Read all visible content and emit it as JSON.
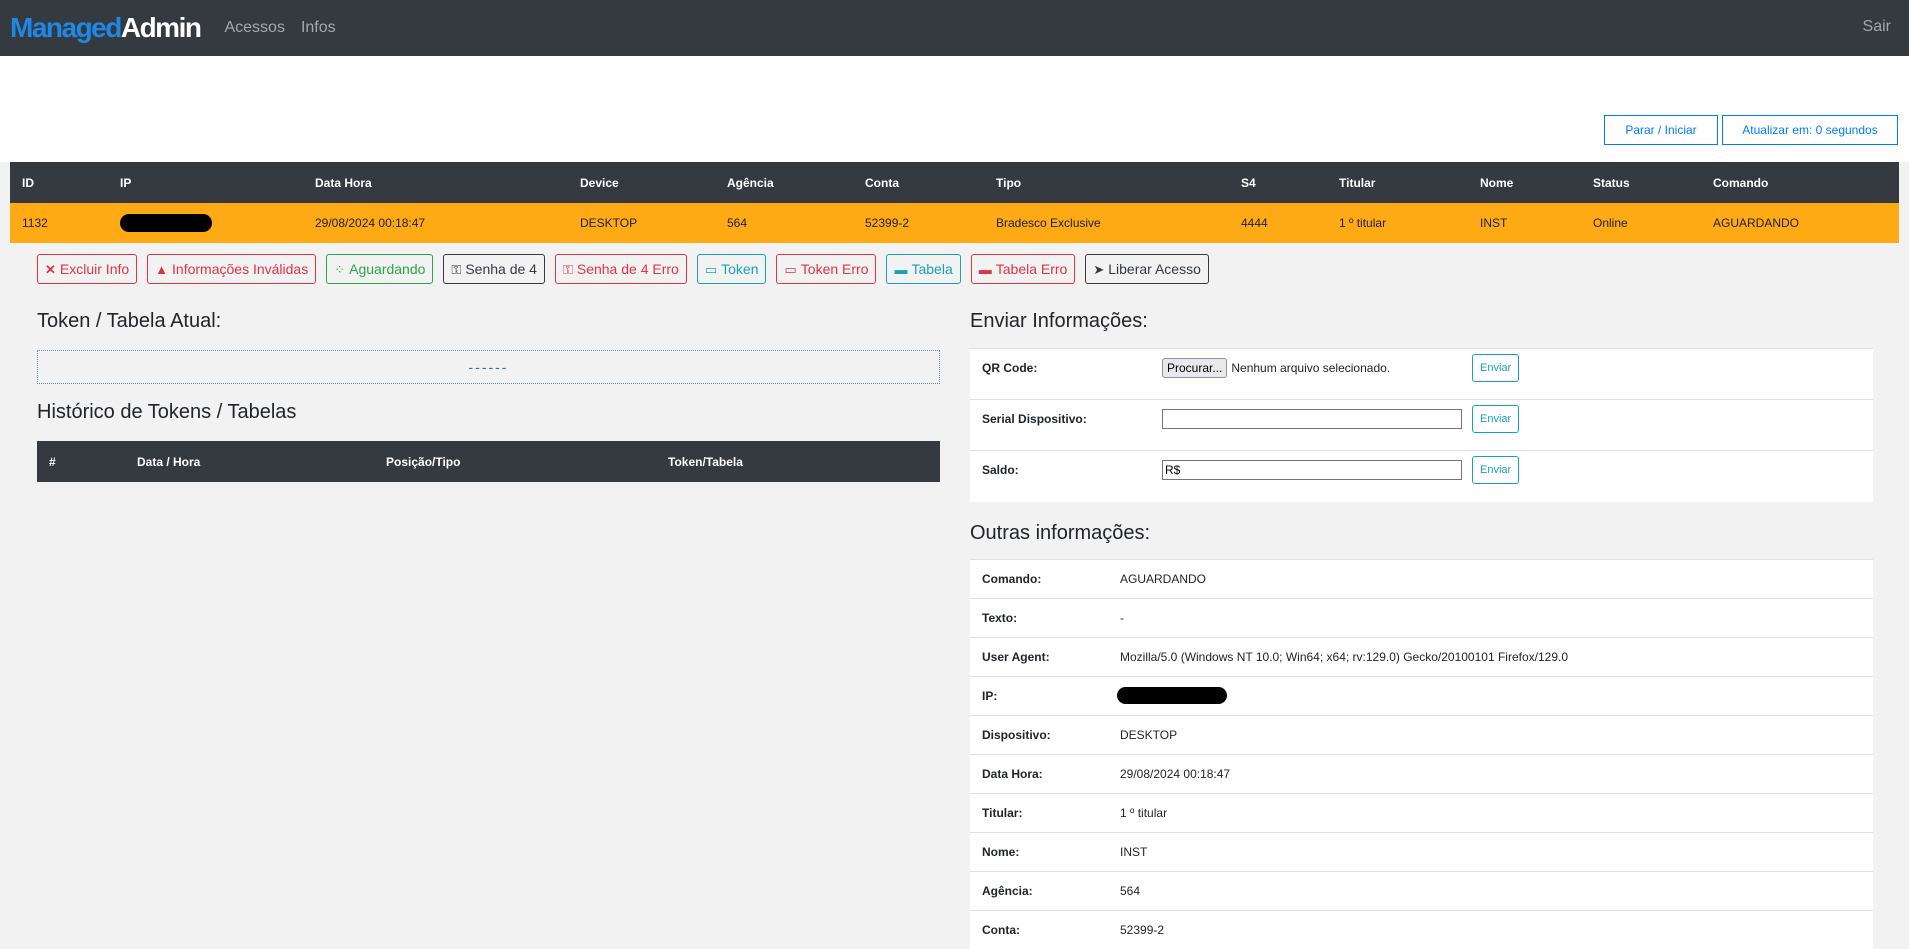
{
  "navbar": {
    "brand_part1": "Managed",
    "brand_part2": "Admin",
    "links": [
      "Acessos",
      "Infos"
    ],
    "logout": "Sair"
  },
  "top_buttons": {
    "stop_start": "Parar / Iniciar",
    "refresh": "Atualizar em: 0 segundos"
  },
  "main_table": {
    "headers": [
      "ID",
      "IP",
      "Data Hora",
      "Device",
      "Agência",
      "Conta",
      "Tipo",
      "S4",
      "Titular",
      "Nome",
      "Status",
      "Comando"
    ],
    "row": {
      "id": "1132",
      "ip": "",
      "data_hora": "29/08/2024 00:18:47",
      "device": "DESKTOP",
      "agencia": "564",
      "conta": "52399-2",
      "tipo": "Bradesco Exclusive",
      "s4": "4444",
      "titular": "1 º titular",
      "nome": "INST",
      "status": "Online",
      "comando": "AGUARDANDO"
    },
    "row_color": "#fdaa14",
    "status_color": "#28a745"
  },
  "action_buttons": [
    {
      "label": "Excluir Info",
      "icon": "x-icon",
      "color": "#dc3545"
    },
    {
      "label": "Informações Inválidas",
      "icon": "warning-icon",
      "color": "#dc3545"
    },
    {
      "label": "Aguardando",
      "icon": "spinner-icon",
      "color": "#28a745"
    },
    {
      "label": "Senha de 4",
      "icon": "key-icon",
      "color": "#343a40"
    },
    {
      "label": "Senha de 4 Erro",
      "icon": "key-icon",
      "color": "#dc3545"
    },
    {
      "label": "Token",
      "icon": "card-icon",
      "color": "#17a2b8"
    },
    {
      "label": "Token Erro",
      "icon": "card-icon",
      "color": "#dc3545"
    },
    {
      "label": "Tabela",
      "icon": "credit-card-icon",
      "color": "#17a2b8"
    },
    {
      "label": "Tabela Erro",
      "icon": "credit-card-icon",
      "color": "#dc3545"
    },
    {
      "label": "Liberar Acesso",
      "icon": "paper-plane-icon",
      "color": "#343a40"
    }
  ],
  "current": {
    "title": "Token / Tabela Atual:",
    "value": "------"
  },
  "history": {
    "title": "Histórico de Tokens / Tabelas",
    "headers": [
      "#",
      "Data / Hora",
      "Posição/Tipo",
      "Token/Tabela"
    ]
  },
  "send": {
    "title": "Enviar Informações:",
    "qr_label": "QR Code:",
    "file_button": "Procurar...",
    "file_status": "Nenhum arquivo selecionado.",
    "serial_label": "Serial Dispositivo:",
    "serial_value": "",
    "saldo_label": "Saldo:",
    "saldo_value": "R$",
    "send_label": "Enviar"
  },
  "other": {
    "title": "Outras informações:",
    "rows": [
      {
        "label": "Comando:",
        "value": "AGUARDANDO"
      },
      {
        "label": "Texto:",
        "value": "-"
      },
      {
        "label": "User Agent:",
        "value": "Mozilla/5.0 (Windows NT 10.0; Win64; x64; rv:129.0) Gecko/20100101 Firefox/129.0"
      },
      {
        "label": "IP:",
        "value": ""
      },
      {
        "label": "Dispositivo:",
        "value": "DESKTOP"
      },
      {
        "label": "Data Hora:",
        "value": "29/08/2024 00:18:47"
      },
      {
        "label": "Titular:",
        "value": "1 º titular"
      },
      {
        "label": "Nome:",
        "value": "INST"
      },
      {
        "label": "Agência:",
        "value": "564"
      },
      {
        "label": "Conta:",
        "value": "52399-2"
      }
    ]
  }
}
